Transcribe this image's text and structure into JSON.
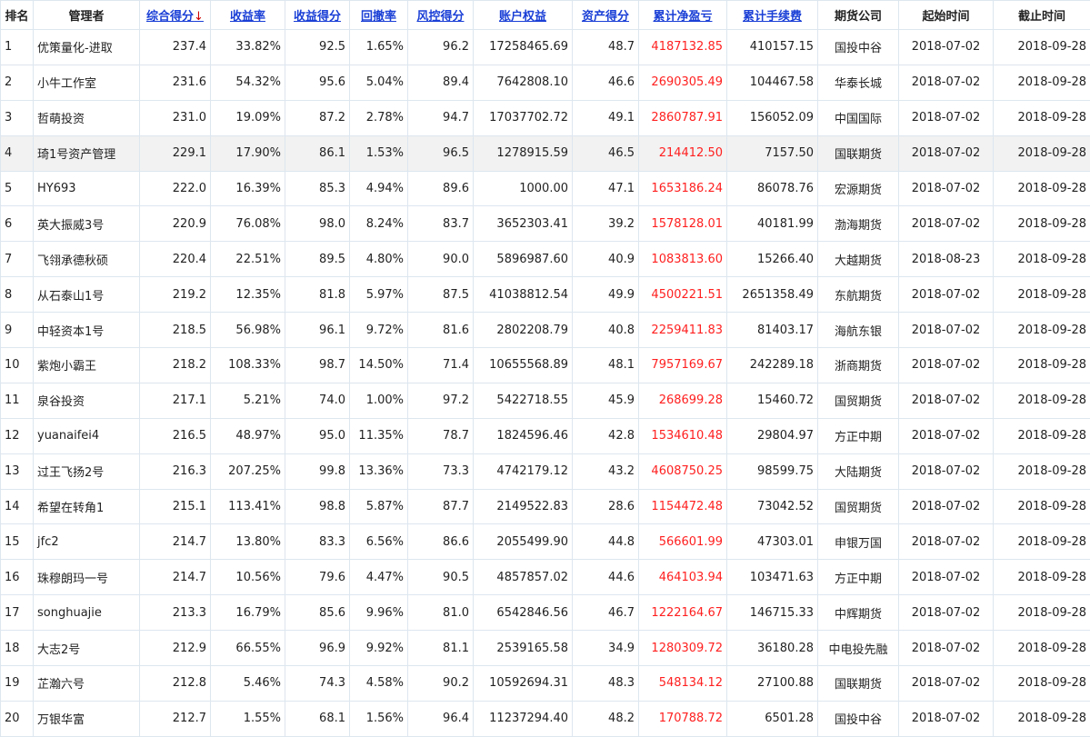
{
  "colors": {
    "link_header": "#1a3fd6",
    "sort_arrow": "#d00000",
    "pnl": "#ff1f1f",
    "highlight_row": "#f2f2f2"
  },
  "table": {
    "headers": [
      {
        "label": "排名",
        "sortable": false
      },
      {
        "label": "管理者",
        "sortable": false
      },
      {
        "label": "综合得分",
        "sortable": true,
        "sort_arrow": "↓"
      },
      {
        "label": "收益率",
        "sortable": true
      },
      {
        "label": "收益得分",
        "sortable": true
      },
      {
        "label": "回撤率",
        "sortable": true
      },
      {
        "label": "风控得分",
        "sortable": true
      },
      {
        "label": "账户权益",
        "sortable": true
      },
      {
        "label": "资产得分",
        "sortable": true
      },
      {
        "label": "累计净盈亏",
        "sortable": true
      },
      {
        "label": "累计手续费",
        "sortable": true
      },
      {
        "label": "期货公司",
        "sortable": false
      },
      {
        "label": "起始时间",
        "sortable": false
      },
      {
        "label": "截止时间",
        "sortable": false
      }
    ],
    "highlight_row_index": 3,
    "rows": [
      [
        "1",
        "优策量化-进取",
        "237.4",
        "33.82%",
        "92.5",
        "1.65%",
        "96.2",
        "17258465.69",
        "48.7",
        "4187132.85",
        "410157.15",
        "国投中谷",
        "2018-07-02",
        "2018-09-28"
      ],
      [
        "2",
        "小牛工作室",
        "231.6",
        "54.32%",
        "95.6",
        "5.04%",
        "89.4",
        "7642808.10",
        "46.6",
        "2690305.49",
        "104467.58",
        "华泰长城",
        "2018-07-02",
        "2018-09-28"
      ],
      [
        "3",
        "哲萌投资",
        "231.0",
        "19.09%",
        "87.2",
        "2.78%",
        "94.7",
        "17037702.72",
        "49.1",
        "2860787.91",
        "156052.09",
        "中国国际",
        "2018-07-02",
        "2018-09-28"
      ],
      [
        "4",
        "琦1号资产管理",
        "229.1",
        "17.90%",
        "86.1",
        "1.53%",
        "96.5",
        "1278915.59",
        "46.5",
        "214412.50",
        "7157.50",
        "国联期货",
        "2018-07-02",
        "2018-09-28"
      ],
      [
        "5",
        "HY693",
        "222.0",
        "16.39%",
        "85.3",
        "4.94%",
        "89.6",
        "1000.00",
        "47.1",
        "1653186.24",
        "86078.76",
        "宏源期货",
        "2018-07-02",
        "2018-09-28"
      ],
      [
        "6",
        "英大振威3号",
        "220.9",
        "76.08%",
        "98.0",
        "8.24%",
        "83.7",
        "3652303.41",
        "39.2",
        "1578128.01",
        "40181.99",
        "渤海期货",
        "2018-07-02",
        "2018-09-28"
      ],
      [
        "7",
        "飞翎承德秋硕",
        "220.4",
        "22.51%",
        "89.5",
        "4.80%",
        "90.0",
        "5896987.60",
        "40.9",
        "1083813.60",
        "15266.40",
        "大越期货",
        "2018-08-23",
        "2018-09-28"
      ],
      [
        "8",
        "从石泰山1号",
        "219.2",
        "12.35%",
        "81.8",
        "5.97%",
        "87.5",
        "41038812.54",
        "49.9",
        "4500221.51",
        "2651358.49",
        "东航期货",
        "2018-07-02",
        "2018-09-28"
      ],
      [
        "9",
        "中轻资本1号",
        "218.5",
        "56.98%",
        "96.1",
        "9.72%",
        "81.6",
        "2802208.79",
        "40.8",
        "2259411.83",
        "81403.17",
        "海航东银",
        "2018-07-02",
        "2018-09-28"
      ],
      [
        "10",
        "紫炮小霸王",
        "218.2",
        "108.33%",
        "98.7",
        "14.50%",
        "71.4",
        "10655568.89",
        "48.1",
        "7957169.67",
        "242289.18",
        "浙商期货",
        "2018-07-02",
        "2018-09-28"
      ],
      [
        "11",
        "泉谷投资",
        "217.1",
        "5.21%",
        "74.0",
        "1.00%",
        "97.2",
        "5422718.55",
        "45.9",
        "268699.28",
        "15460.72",
        "国贸期货",
        "2018-07-02",
        "2018-09-28"
      ],
      [
        "12",
        "yuanaifei4",
        "216.5",
        "48.97%",
        "95.0",
        "11.35%",
        "78.7",
        "1824596.46",
        "42.8",
        "1534610.48",
        "29804.97",
        "方正中期",
        "2018-07-02",
        "2018-09-28"
      ],
      [
        "13",
        "过王飞扬2号",
        "216.3",
        "207.25%",
        "99.8",
        "13.36%",
        "73.3",
        "4742179.12",
        "43.2",
        "4608750.25",
        "98599.75",
        "大陆期货",
        "2018-07-02",
        "2018-09-28"
      ],
      [
        "14",
        "希望在转角1",
        "215.1",
        "113.41%",
        "98.8",
        "5.87%",
        "87.7",
        "2149522.83",
        "28.6",
        "1154472.48",
        "73042.52",
        "国贸期货",
        "2018-07-02",
        "2018-09-28"
      ],
      [
        "15",
        "jfc2",
        "214.7",
        "13.80%",
        "83.3",
        "6.56%",
        "86.6",
        "2055499.90",
        "44.8",
        "566601.99",
        "47303.01",
        "申银万国",
        "2018-07-02",
        "2018-09-28"
      ],
      [
        "16",
        "珠穆朗玛一号",
        "214.7",
        "10.56%",
        "79.6",
        "4.47%",
        "90.5",
        "4857857.02",
        "44.6",
        "464103.94",
        "103471.63",
        "方正中期",
        "2018-07-02",
        "2018-09-28"
      ],
      [
        "17",
        "songhuajie",
        "213.3",
        "16.79%",
        "85.6",
        "9.96%",
        "81.0",
        "6542846.56",
        "46.7",
        "1222164.67",
        "146715.33",
        "中辉期货",
        "2018-07-02",
        "2018-09-28"
      ],
      [
        "18",
        "大志2号",
        "212.9",
        "66.55%",
        "96.9",
        "9.92%",
        "81.1",
        "2539165.58",
        "34.9",
        "1280309.72",
        "36180.28",
        "中电投先融",
        "2018-07-02",
        "2018-09-28"
      ],
      [
        "19",
        "芷瀚六号",
        "212.8",
        "5.46%",
        "74.3",
        "4.58%",
        "90.2",
        "10592694.31",
        "48.3",
        "548134.12",
        "27100.88",
        "国联期货",
        "2018-07-02",
        "2018-09-28"
      ],
      [
        "20",
        "万银华富",
        "212.7",
        "1.55%",
        "68.1",
        "1.56%",
        "96.4",
        "11237294.40",
        "48.2",
        "170788.72",
        "6501.28",
        "国投中谷",
        "2018-07-02",
        "2018-09-28"
      ]
    ]
  }
}
